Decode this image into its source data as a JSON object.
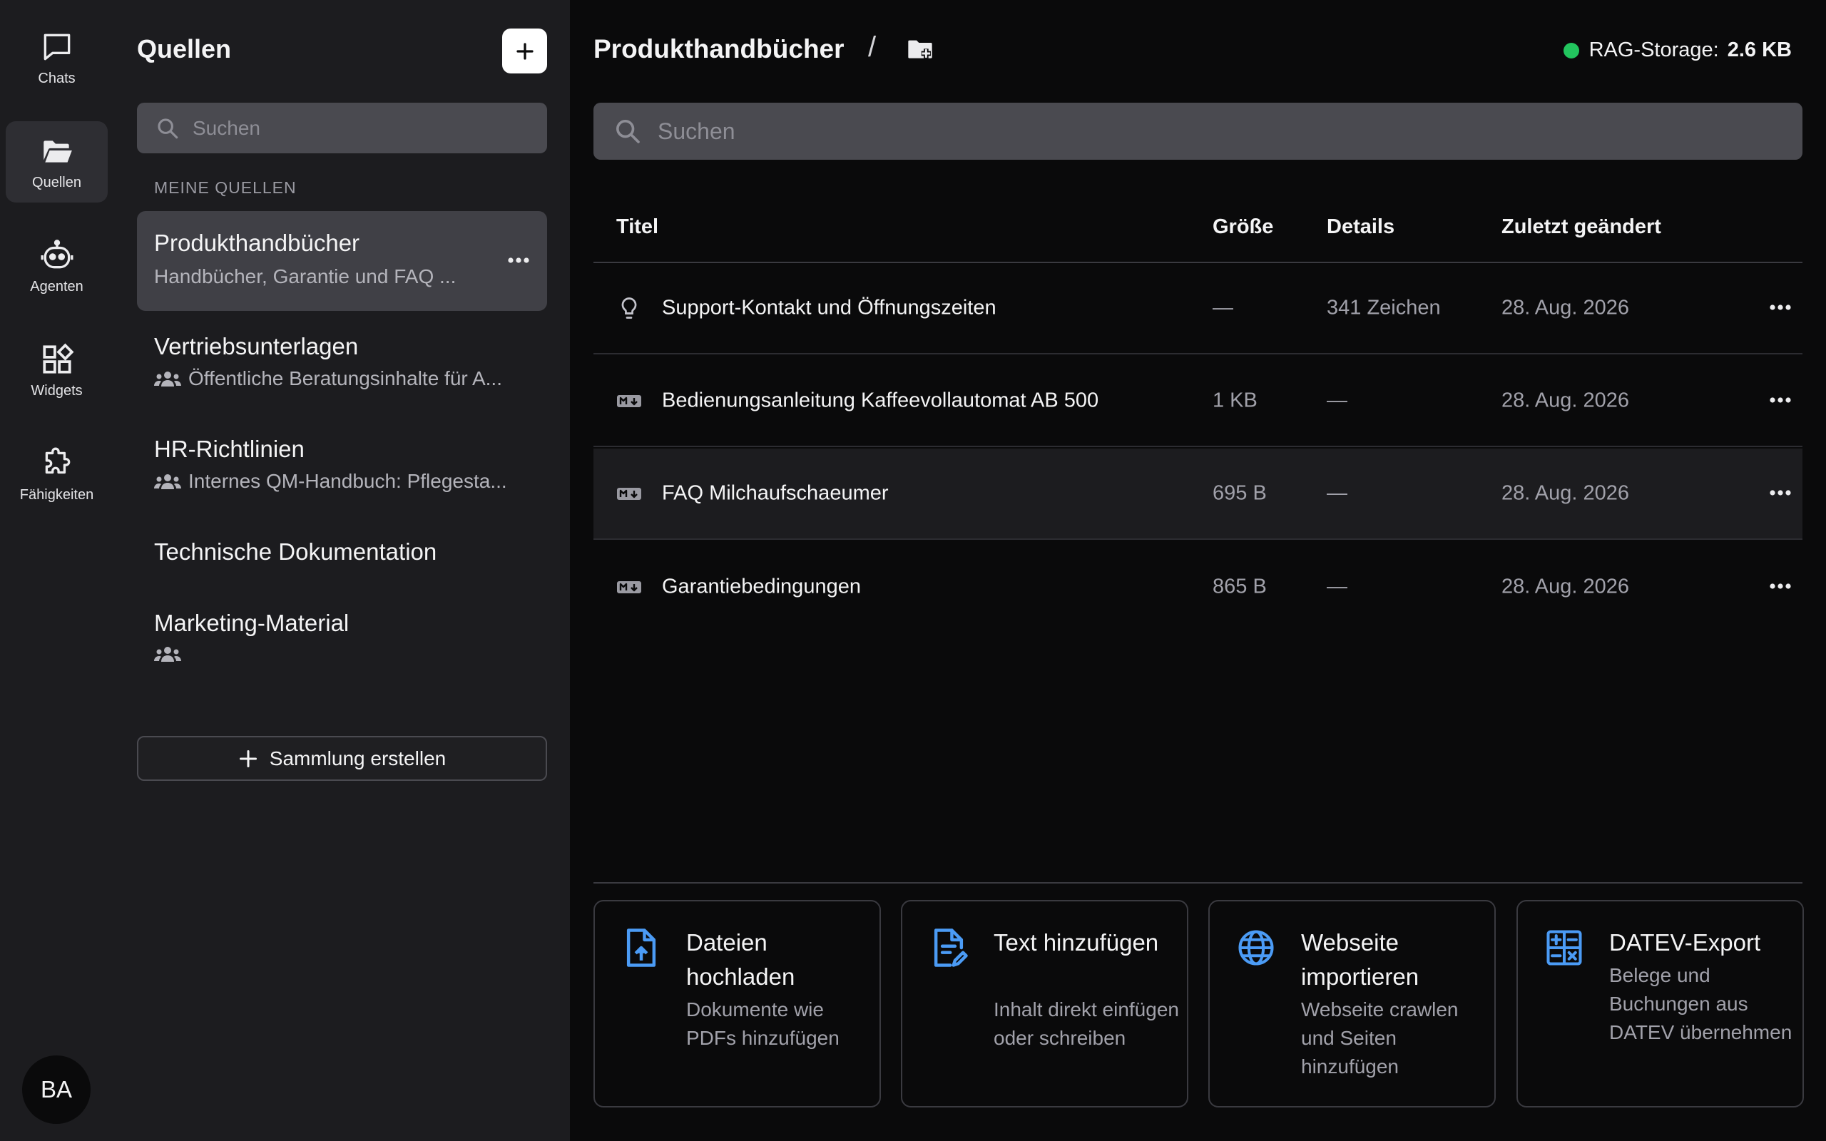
{
  "rail": {
    "items": [
      {
        "label": "Chats",
        "icon": "chat-bubble-icon"
      },
      {
        "label": "Quellen",
        "icon": "folder-open-icon",
        "active": true
      },
      {
        "label": "Agenten",
        "icon": "robot-icon"
      },
      {
        "label": "Widgets",
        "icon": "widgets-icon"
      },
      {
        "label": "Fähigkeiten",
        "icon": "puzzle-icon"
      }
    ],
    "avatar": "BA"
  },
  "sources": {
    "title": "Quellen",
    "search_placeholder": "Suchen",
    "section_label": "MEINE QUELLEN",
    "collections": [
      {
        "title": "Produkthandbücher",
        "subtitle": "Handbücher, Garantie und FAQ ...",
        "active": true,
        "shared": false
      },
      {
        "title": "Vertriebsunterlagen",
        "subtitle": "Öffentliche Beratungsinhalte für A...",
        "shared": true
      },
      {
        "title": "HR-Richtlinien",
        "subtitle": "Internes QM-Handbuch: Pflegesta...",
        "shared": true
      },
      {
        "title": "Technische Dokumentation",
        "subtitle": "",
        "shared": false
      },
      {
        "title": "Marketing-Material",
        "subtitle": "",
        "shared": true
      }
    ],
    "create_label": "Sammlung erstellen"
  },
  "main": {
    "breadcrumb_title": "Produkthandbücher",
    "breadcrumb_sep": "/",
    "storage_label": "RAG-Storage:",
    "storage_value": "2.6 KB",
    "search_placeholder": "Suchen",
    "columns": {
      "title": "Titel",
      "size": "Größe",
      "details": "Details",
      "modified": "Zuletzt geändert"
    },
    "rows": [
      {
        "title": "Support-Kontakt und Öffnungszeiten",
        "icon": "lightbulb-icon",
        "size": "—",
        "details": "341 Zeichen",
        "modified": "28. Aug. 2026"
      },
      {
        "title": "Bedienungsanleitung Kaffeevollautomat AB 500",
        "icon": "markdown-icon",
        "size": "1 KB",
        "details": "—",
        "modified": "28. Aug. 2026"
      },
      {
        "title": "FAQ Milchaufschaeumer",
        "icon": "markdown-icon",
        "size": "695 B",
        "details": "—",
        "modified": "28. Aug. 2026"
      },
      {
        "title": "Garantiebedingungen",
        "icon": "markdown-icon",
        "size": "865 B",
        "details": "—",
        "modified": "28. Aug. 2026"
      }
    ],
    "cards": [
      {
        "title": "Dateien hochladen",
        "desc": "Dokumente wie PDFs hinzufügen",
        "icon": "file-upload-icon"
      },
      {
        "title": "Text hinzufügen",
        "desc": "Inhalt direkt einfügen oder schreiben",
        "icon": "file-edit-icon"
      },
      {
        "title": "Webseite importieren",
        "desc": "Webseite crawlen und Seiten hinzufügen",
        "icon": "globe-icon"
      },
      {
        "title": "DATEV-Export",
        "desc": "Belege und Buchungen aus DATEV übernehmen",
        "icon": "calculator-icon"
      }
    ],
    "accent_color": "#4b9bf5"
  }
}
